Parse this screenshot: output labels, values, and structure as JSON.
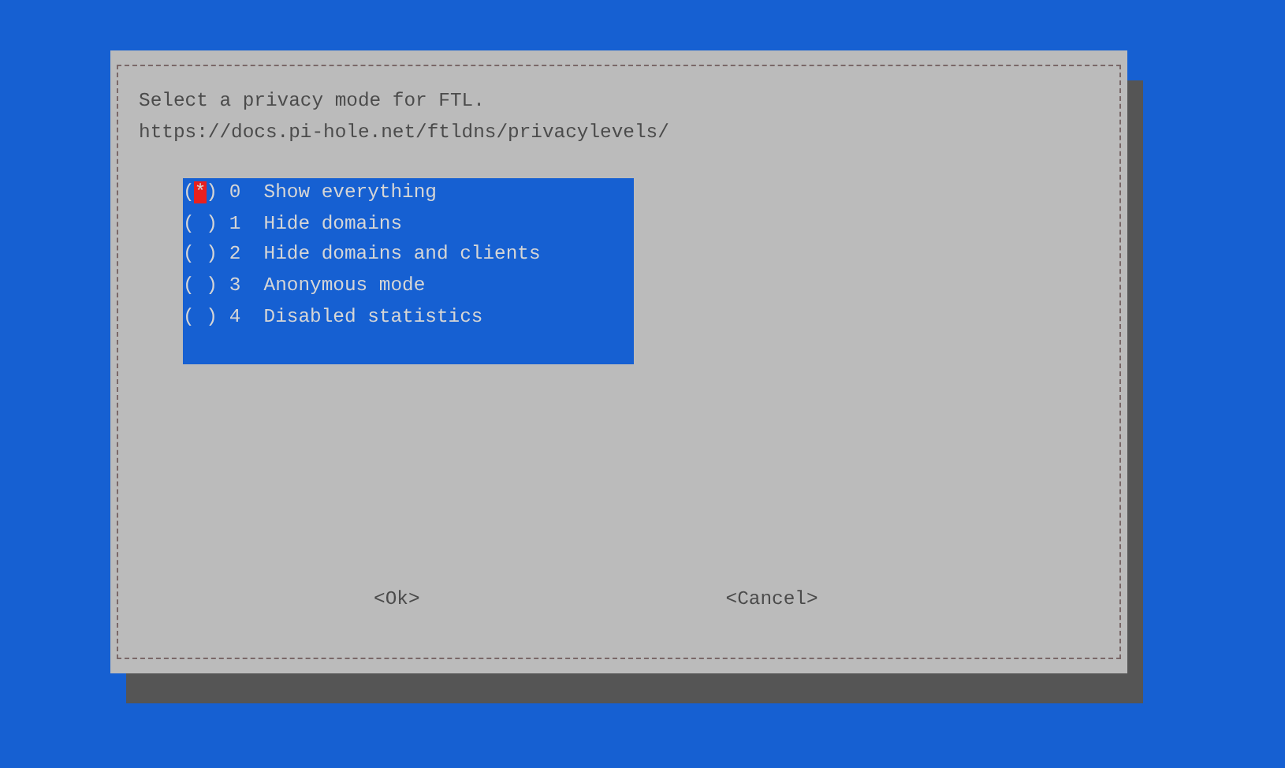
{
  "dialog": {
    "text_lines": [
      "Select a privacy mode for FTL.",
      "https://docs.pi-hole.net/ftldns/privacylevels/"
    ],
    "options": [
      {
        "marker": "(*)",
        "label": "0  Show everything",
        "selected": true
      },
      {
        "marker": "( )",
        "label": "1  Hide domains",
        "selected": false
      },
      {
        "marker": "( )",
        "label": "2  Hide domains and clients",
        "selected": false
      },
      {
        "marker": "( )",
        "label": "3  Anonymous mode",
        "selected": false
      },
      {
        "marker": "( )",
        "label": "4  Disabled statistics",
        "selected": false
      }
    ],
    "buttons": [
      "<Ok>",
      "<Cancel>"
    ]
  }
}
